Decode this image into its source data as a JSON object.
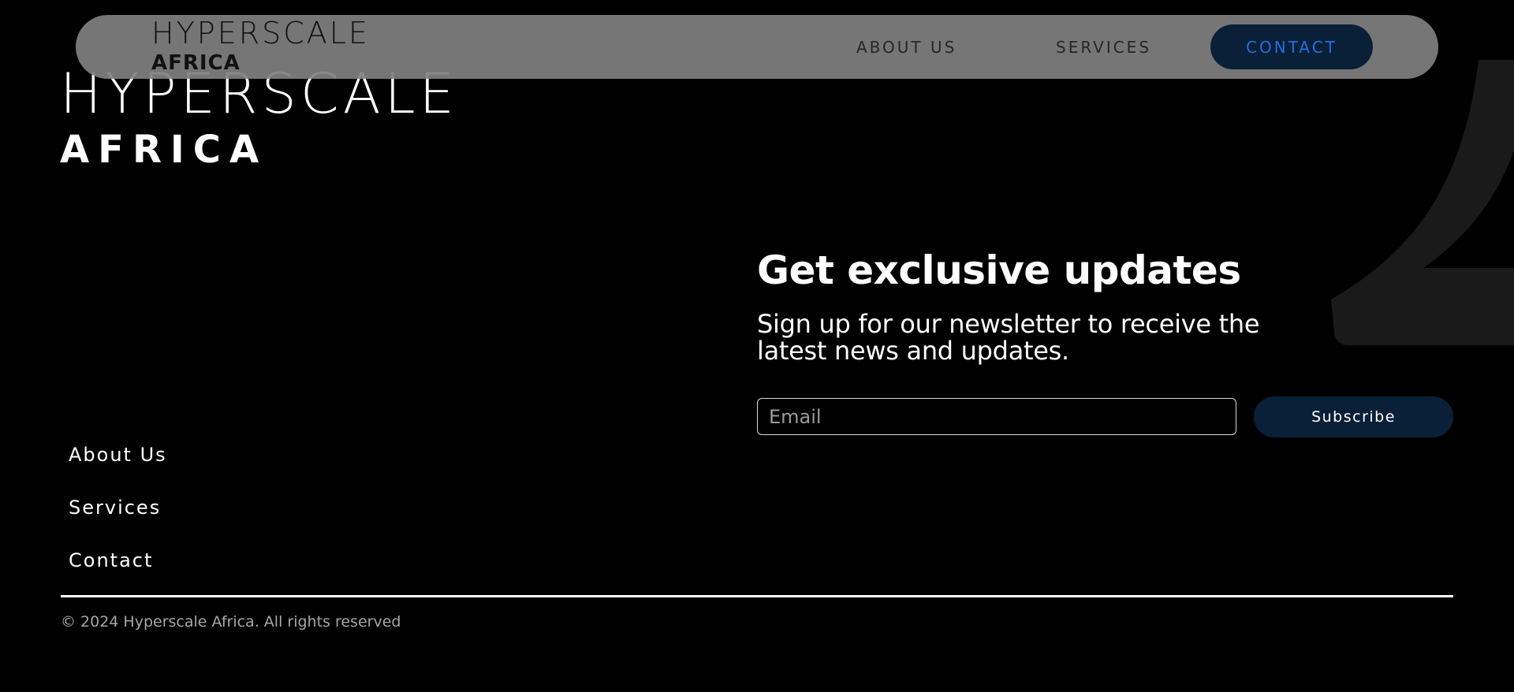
{
  "navbar": {
    "logo_line1": "HYPERSCALE",
    "logo_line2": "AFRICA",
    "links": {
      "about": "ABOUT US",
      "services": "SERVICES",
      "contact": "CONTACT"
    }
  },
  "footer_logo": {
    "line1": "HYPERSCALE",
    "line2": "AFRICA"
  },
  "newsletter": {
    "title": "Get exclusive updates",
    "subtitle": "Sign up for our newsletter to receive the latest news and updates.",
    "email_placeholder": "Email",
    "email_value": "",
    "subscribe_label": "Subscribe"
  },
  "footer_links": {
    "about": "About Us",
    "services": "Services",
    "contact": "Contact"
  },
  "copyright": "© 2024 Hyperscale Africa. All rights reserved",
  "colors": {
    "background": "#000000",
    "navbar_bg": "#808080",
    "button_bg": "#0a2038",
    "contact_text": "#1f6fe0",
    "decorative_glyph": "#1a1a1a"
  }
}
